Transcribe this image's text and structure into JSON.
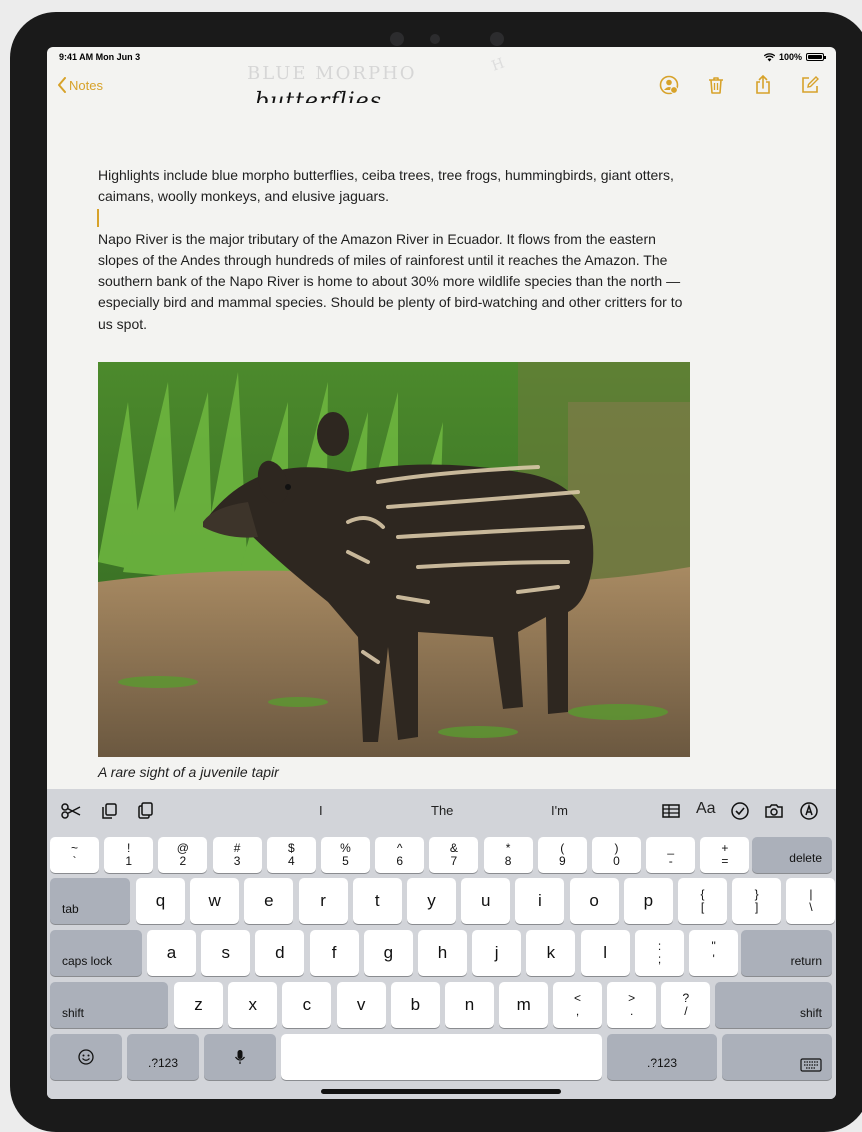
{
  "status": {
    "time": "9:41 AM  Mon Jun 3",
    "battery": "100%"
  },
  "nav": {
    "back_label": "Notes",
    "icons": [
      "add-person-icon",
      "trash-icon",
      "share-icon",
      "compose-icon"
    ],
    "accent": "#d7a22a"
  },
  "sketch": {
    "line1": "BLUE MORPHO",
    "line2": "butterflies"
  },
  "note": {
    "paragraph1": "Highlights include blue morpho butterflies, ceiba trees, tree frogs, hummingbirds, giant otters, caimans, woolly monkeys, and elusive jaguars.",
    "paragraph2": "Napo River is the major tributary of the Amazon River in Ecuador. It flows from the eastern slopes of the Andes through hundreds of miles of rainforest until it reaches the Amazon. The southern bank of the Napo River is home to about 30% more wildlife species than the north — especially bird and mammal species. Should be plenty of bird-watching and other critters for to us spot.",
    "caption": "A rare sight of a juvenile tapir"
  },
  "keyboard": {
    "predictions": [
      "I",
      "The",
      "I'm"
    ],
    "left_tools": [
      "scissors-icon",
      "copy-icon",
      "paste-icon"
    ],
    "right_tools": [
      "table-icon",
      "text-format-icon",
      "checklist-icon",
      "camera-icon",
      "markup-icon"
    ],
    "text_format_label": "Aa",
    "number_row": [
      {
        "top": "~",
        "bottom": "`"
      },
      {
        "top": "!",
        "bottom": "1"
      },
      {
        "top": "@",
        "bottom": "2"
      },
      {
        "top": "#",
        "bottom": "3"
      },
      {
        "top": "$",
        "bottom": "4"
      },
      {
        "top": "%",
        "bottom": "5"
      },
      {
        "top": "^",
        "bottom": "6"
      },
      {
        "top": "&",
        "bottom": "7"
      },
      {
        "top": "*",
        "bottom": "8"
      },
      {
        "top": "(",
        "bottom": "9"
      },
      {
        "top": ")",
        "bottom": "0"
      },
      {
        "top": "_",
        "bottom": "-"
      },
      {
        "top": "+",
        "bottom": "="
      }
    ],
    "delete_label": "delete",
    "tab_label": "tab",
    "row_q": [
      "q",
      "w",
      "e",
      "r",
      "t",
      "y",
      "u",
      "i",
      "o",
      "p"
    ],
    "row_q_punct": [
      {
        "top": "{",
        "bottom": "["
      },
      {
        "top": "}",
        "bottom": "]"
      },
      {
        "top": "|",
        "bottom": "\\"
      }
    ],
    "caps_label": "caps lock",
    "row_a": [
      "a",
      "s",
      "d",
      "f",
      "g",
      "h",
      "j",
      "k",
      "l"
    ],
    "row_a_punct": [
      {
        "top": ":",
        "bottom": ";"
      },
      {
        "top": "\"",
        "bottom": "'"
      }
    ],
    "return_label": "return",
    "shift_label": "shift",
    "row_z": [
      "z",
      "x",
      "c",
      "v",
      "b",
      "n",
      "m"
    ],
    "row_z_punct": [
      {
        "top": "<",
        "bottom": ","
      },
      {
        "top": ">",
        "bottom": "."
      },
      {
        "top": "?",
        "bottom": "/"
      }
    ],
    "numbers_label": ".?123"
  }
}
